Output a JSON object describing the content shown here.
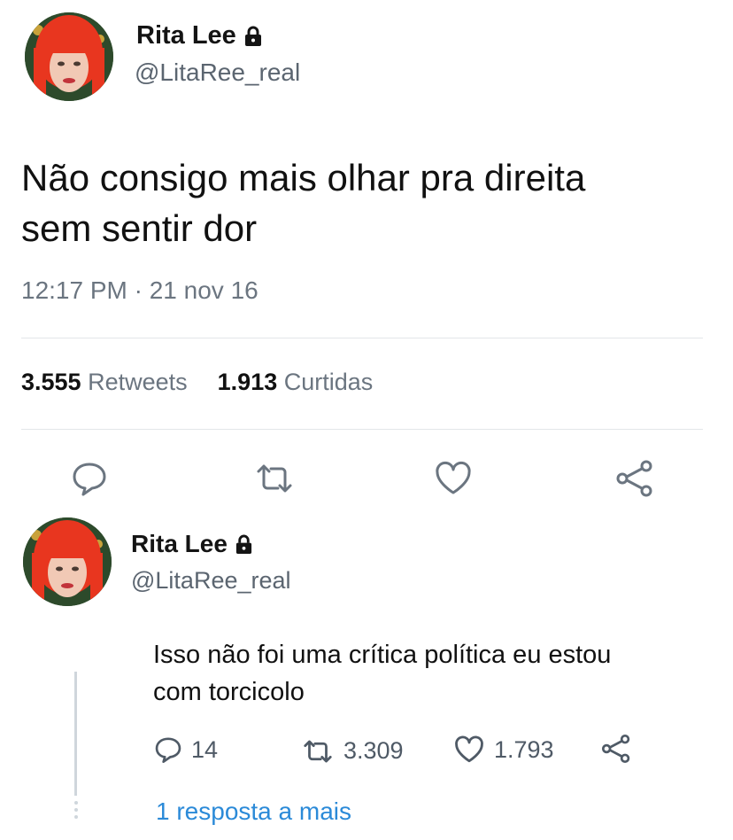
{
  "tweet": {
    "author_name": "Rita Lee",
    "author_handle": "@LitaRee_real",
    "text_line1": "Não consigo mais olhar pra direita",
    "text_line2": "sem sentir dor",
    "timestamp": "12:17 PM · 21 nov 16",
    "retweets_count": "3.555",
    "retweets_label": "Retweets",
    "likes_count": "1.913",
    "likes_label": "Curtidas"
  },
  "reply": {
    "author_name": "Rita Lee",
    "author_handle": "@LitaRee_real",
    "text_line1": "Isso não foi uma crítica política eu estou",
    "text_line2": "com torcicolo",
    "replies_count": "14",
    "retweets_count": "3.309",
    "likes_count": "1.793",
    "more_replies_label": "1 resposta a mais"
  },
  "icons": [
    "lock-icon",
    "reply-icon",
    "retweet-icon",
    "like-icon",
    "share-icon"
  ],
  "colors": {
    "link": "#2b8ad8",
    "muted": "#6b7580",
    "avatar_hair": "#e8361f"
  }
}
